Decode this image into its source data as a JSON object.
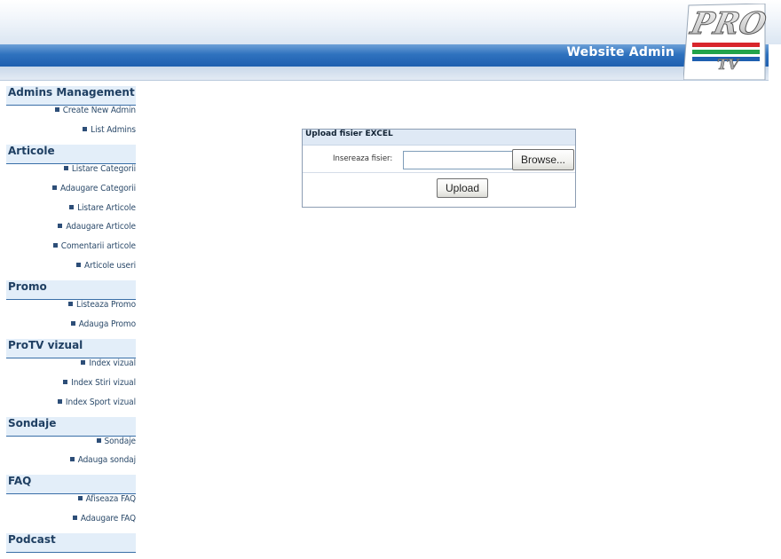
{
  "header": {
    "title": "Website Admin",
    "logo_text": "PRO",
    "logo_subtext": "TV",
    "colors": {
      "band": "#2f72be",
      "logo_red": "#d8262c",
      "logo_green": "#22a34a",
      "logo_blue": "#1e5fb0"
    }
  },
  "sidebar": {
    "sections": [
      {
        "title": "Admins Management",
        "items": [
          "Create New Admin",
          "List Admins"
        ]
      },
      {
        "title": "Articole",
        "items": [
          "Listare Categorii",
          "Adaugare Categorii",
          "Listare Articole",
          "Adaugare Articole",
          "Comentarii articole",
          "Articole useri"
        ]
      },
      {
        "title": "Promo",
        "items": [
          "Listeaza Promo",
          "Adauga Promo"
        ]
      },
      {
        "title": "ProTV vizual",
        "items": [
          "Index vizual",
          "Index Stiri vizual",
          "Index Sport vizual"
        ]
      },
      {
        "title": "Sondaje",
        "items": [
          "Sondaje",
          "Adauga sondaj"
        ]
      },
      {
        "title": "FAQ",
        "items": [
          "Afiseaza FAQ",
          "Adaugare FAQ"
        ]
      },
      {
        "title": "Podcast",
        "items": []
      }
    ]
  },
  "upload_form": {
    "title": "Upload fisier EXCEL",
    "file_label": "Insereaza fisier:",
    "file_value": "",
    "browse_label": "Browse...",
    "submit_label": "Upload"
  }
}
